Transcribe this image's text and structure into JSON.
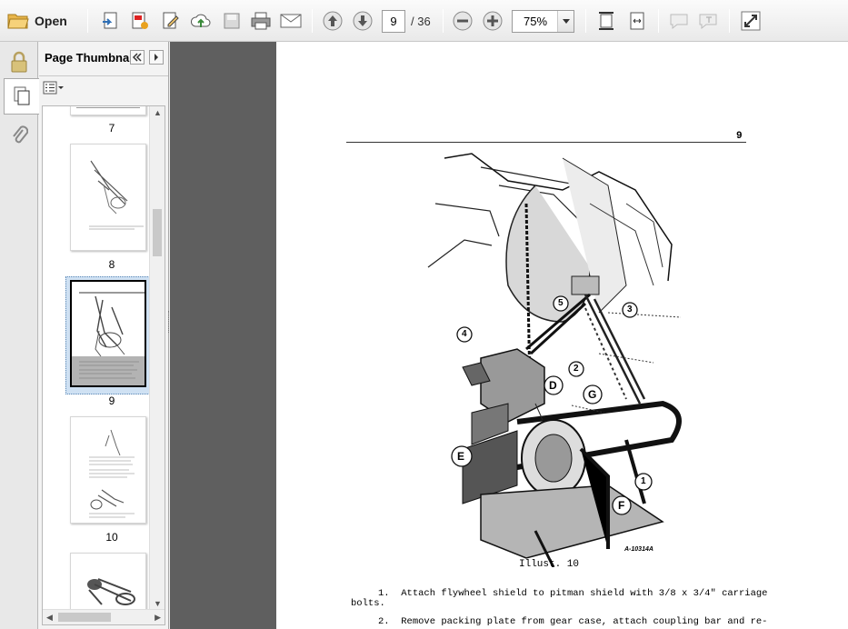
{
  "toolbar": {
    "open_label": "Open",
    "page_current": "9",
    "page_total": "/ 36",
    "zoom": "75%",
    "icons": [
      "open-folder-icon",
      "create-pdf-icon",
      "export-pdf-icon",
      "edit-pdf-icon",
      "cloud-upload-icon",
      "save-icon",
      "print-icon",
      "email-icon",
      "page-up-icon",
      "page-down-icon",
      "zoom-out-icon",
      "zoom-in-icon",
      "fit-page-icon",
      "fit-width-icon",
      "comment-icon",
      "highlight-icon",
      "fullscreen-icon"
    ]
  },
  "panel": {
    "title": "Page Thumbna...",
    "thumbnails": [
      {
        "label": "7"
      },
      {
        "label": "8"
      },
      {
        "label": "9",
        "selected": true
      },
      {
        "label": "10"
      }
    ]
  },
  "document": {
    "page_number": "9",
    "illustration_code": "A-10314A",
    "caption": "Illust. 10",
    "callouts": [
      "1",
      "2",
      "3",
      "4",
      "5",
      "D",
      "E",
      "F",
      "G"
    ],
    "steps": [
      {
        "num": "1.",
        "line1": "Attach flywheel shield to pitman shield with 3/8 x 3/4\" carriage",
        "line2": "bolts."
      },
      {
        "num": "2.",
        "line1": "Remove packing plate from gear case, attach coupling bar and re-"
      }
    ]
  }
}
